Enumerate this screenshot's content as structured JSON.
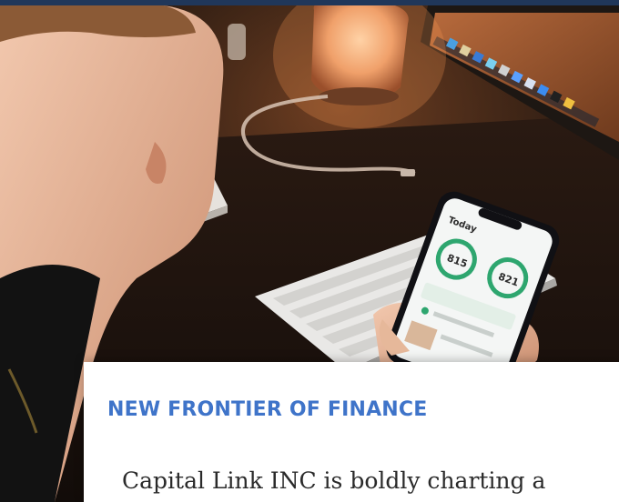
{
  "hero": {
    "image_subject": "person-using-phone-finance-app",
    "phone": {
      "header": "Today",
      "score_left": "815",
      "score_right": "821"
    }
  },
  "card": {
    "heading": "NEW FRONTIER OF FINANCE",
    "body": "Capital Link INC is boldly charting a"
  },
  "colors": {
    "frame": "#20375a",
    "heading": "#3f74c9",
    "body_text": "#2a2a2a",
    "card_bg": "#ffffff"
  }
}
